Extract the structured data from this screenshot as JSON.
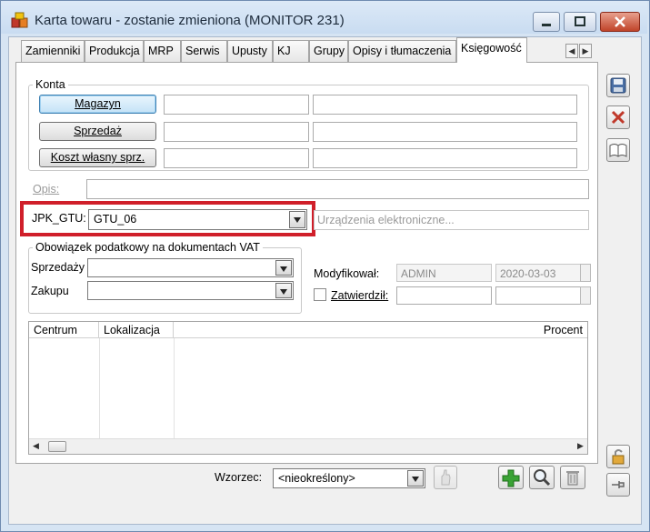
{
  "window": {
    "title": "Karta towaru - zostanie zmieniona (MONITOR 231)",
    "icon": "boxes-app-icon"
  },
  "tabs": [
    {
      "label": "Zamienniki",
      "active": false
    },
    {
      "label": "Produkcja",
      "active": false
    },
    {
      "label": "MRP",
      "active": false
    },
    {
      "label": "Serwis",
      "active": false
    },
    {
      "label": "Upusty",
      "active": false
    },
    {
      "label": "KJ",
      "active": false
    },
    {
      "label": "Grupy",
      "active": false
    },
    {
      "label": "Opisy i tłumaczenia",
      "active": false
    },
    {
      "label": "Księgowość",
      "active": true
    }
  ],
  "konta": {
    "group_label": "Konta",
    "buttons": [
      "Magazyn",
      "Sprzedaż",
      "Koszt własny sprz."
    ]
  },
  "opis": {
    "label": "Opis:",
    "value": ""
  },
  "jpk": {
    "label": "JPK_GTU:",
    "value": "GTU_06",
    "description_placeholder": "Urządzenia elektroniczne...",
    "highlight_color": "#d01f2a"
  },
  "vat": {
    "group_label": "Obowiązek podatkowy na dokumentach VAT",
    "sprzedazy_label": "Sprzedaży",
    "zakupu_label": "Zakupu",
    "sprzedazy_value": "",
    "zakupu_value": ""
  },
  "modyfikowal": {
    "label": "Modyfikował:",
    "user": "ADMIN",
    "date": "2020-03-03"
  },
  "zatwierdzil": {
    "label": "Zatwierdził:",
    "checked": false,
    "user": "",
    "date": ""
  },
  "grid": {
    "columns": [
      "Centrum",
      "Lokalizacja",
      "Procent"
    ],
    "rows": []
  },
  "footer": {
    "wzorzec_label": "Wzorzec:",
    "wzorzec_value": "<nieokreślony>"
  },
  "colors": {
    "accent_green": "#3aa335",
    "close_red": "#c0442a"
  }
}
